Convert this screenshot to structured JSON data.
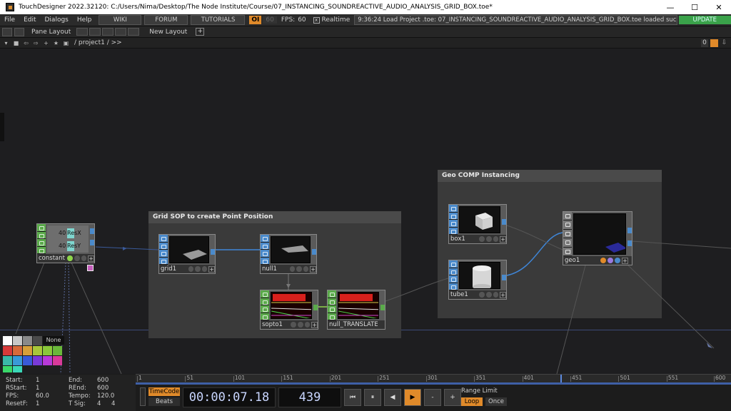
{
  "titlebar": {
    "title": "TouchDesigner 2022.32120: C:/Users/Nima/Desktop/The Node Institute/Course/07_INSTANCING_SOUNDREACTIVE_AUDIO_ANALYSIS_GRID_BOX.toe*",
    "minimize": "—",
    "maximize": "☐",
    "close": "✕"
  },
  "menu": {
    "items": [
      "File",
      "Edit",
      "Dialogs",
      "Help"
    ],
    "links": [
      "WIKI",
      "FORUM",
      "TUTORIALS"
    ],
    "oi": "OI",
    "fps_target": "60",
    "fps_label": "FPS:",
    "fps_value": "60",
    "realtime_check": "x",
    "realtime": "Realtime",
    "message": "9:36:24 Load Project .toe: 07_INSTANCING_SOUNDREACTIVE_AUDIO_ANALYSIS_GRID_BOX.toe loaded successf",
    "update": "UPDATE"
  },
  "panebar": {
    "pane_layout": "Pane Layout",
    "new_layout": "New Layout",
    "plus": "+"
  },
  "pathbar": {
    "path": "/ project1 / >>",
    "right_num": "0"
  },
  "annotations": {
    "grid": "Grid SOP to create Point Position",
    "geo": "Geo COMP Instancing"
  },
  "nodes": {
    "constant": {
      "name": "constant1",
      "resx_val": "40",
      "resx": "ResX",
      "resy_val": "40",
      "resy": "ResY"
    },
    "grid": {
      "name": "grid1"
    },
    "null1": {
      "name": "null1"
    },
    "sopto": {
      "name": "sopto1"
    },
    "nulltr": {
      "name": "null_TRANSLATE"
    },
    "box": {
      "name": "box1"
    },
    "tube": {
      "name": "tube1"
    },
    "geo": {
      "name": "geo1"
    },
    "plus_glyph": "+"
  },
  "palette": {
    "none": "None"
  },
  "timeline": {
    "ticks": [
      "1",
      "51",
      "101",
      "151",
      "201",
      "251",
      "301",
      "351",
      "401",
      "451",
      "501",
      "551",
      "600"
    ],
    "current_frame": 439,
    "start": 1,
    "end": 600
  },
  "stats": {
    "start_label": "Start:",
    "start": "1",
    "end_label": "End:",
    "end": "600",
    "rstart_label": "RStart:",
    "rstart": "1",
    "rend_label": "REnd:",
    "rend": "600",
    "fps_label": "FPS:",
    "fps": "60.0",
    "tempo_label": "Tempo:",
    "tempo": "120.0",
    "resetf_label": "ResetF:",
    "resetf": "1",
    "tsig_label": "T Sig:",
    "tsig_a": "4",
    "tsig_b": "4"
  },
  "transport": {
    "timecode_tab": "TimeCode",
    "beats_tab": "Beats",
    "timecode": "00:00:07.18",
    "frame": "439",
    "buttons": [
      "⏮",
      "⏸",
      "◀",
      "▶",
      "-",
      "+"
    ],
    "range_limit": "Range Limit",
    "loop": "Loop",
    "once": "Once"
  },
  "colors": {
    "accent": "#e08a2a",
    "sop": "#4a8acb",
    "chop": "#5aaa4a",
    "wire_blue": "#3f86d8",
    "timeline_blue": "#3e5fa6"
  }
}
